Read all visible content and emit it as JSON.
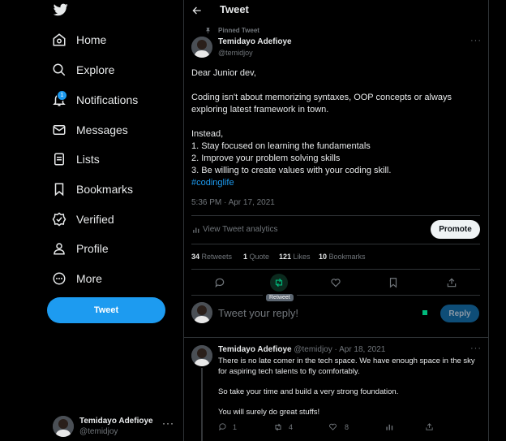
{
  "sidebar": {
    "items": [
      {
        "label": "Home",
        "icon": "home-icon"
      },
      {
        "label": "Explore",
        "icon": "search-icon"
      },
      {
        "label": "Notifications",
        "icon": "bell-icon",
        "badge": "1"
      },
      {
        "label": "Messages",
        "icon": "envelope-icon"
      },
      {
        "label": "Lists",
        "icon": "list-icon"
      },
      {
        "label": "Bookmarks",
        "icon": "bookmark-icon"
      },
      {
        "label": "Verified",
        "icon": "verified-icon"
      },
      {
        "label": "Profile",
        "icon": "person-icon"
      },
      {
        "label": "More",
        "icon": "more-circle-icon"
      }
    ],
    "tweet_button": "Tweet",
    "account": {
      "name": "Temidayo Adefioye",
      "handle": "@temidjoy"
    }
  },
  "header": {
    "title": "Tweet"
  },
  "tweet": {
    "pinned_label": "Pinned Tweet",
    "author_name": "Temidayo Adefioye",
    "author_handle": "@temidjoy",
    "lines": [
      "Dear Junior dev,",
      "Coding isn't about memorizing syntaxes, OOP concepts or always",
      "exploring latest framework in town.",
      "Instead,",
      "1. Stay focused on learning the fundamentals",
      "2. Improve your problem solving skills",
      "3. Be willing to create values with your coding skill."
    ],
    "hashtag": "#codinglife",
    "timestamp": "5:36 PM · Apr 17, 2021",
    "analytics_label": "View Tweet analytics",
    "promote_label": "Promote",
    "stats": {
      "retweets_count": "34",
      "retweets_label": "Retweets",
      "quotes_count": "1",
      "quotes_label": "Quote",
      "likes_count": "121",
      "likes_label": "Likes",
      "bookmarks_count": "10",
      "bookmarks_label": "Bookmarks"
    },
    "retweet_tooltip": "Retweet",
    "reply_placeholder": "Tweet your reply!",
    "reply_button": "Reply"
  },
  "reply_tweet": {
    "author_name": "Temidayo Adefioye",
    "meta": "@temidjoy · Apr 18, 2021",
    "lines": [
      "There is no late comer in the tech space. We have enough space in the sky",
      "for aspiring tech talents to fly comfortably.",
      "So take your time and build a very strong foundation.",
      "You will surely do great stuffs!"
    ],
    "counts": {
      "replies": "1",
      "retweets": "4",
      "likes": "8"
    }
  },
  "colors": {
    "accent": "#1d9bf0",
    "retweet_green": "#00ba7c",
    "background": "#000000"
  }
}
